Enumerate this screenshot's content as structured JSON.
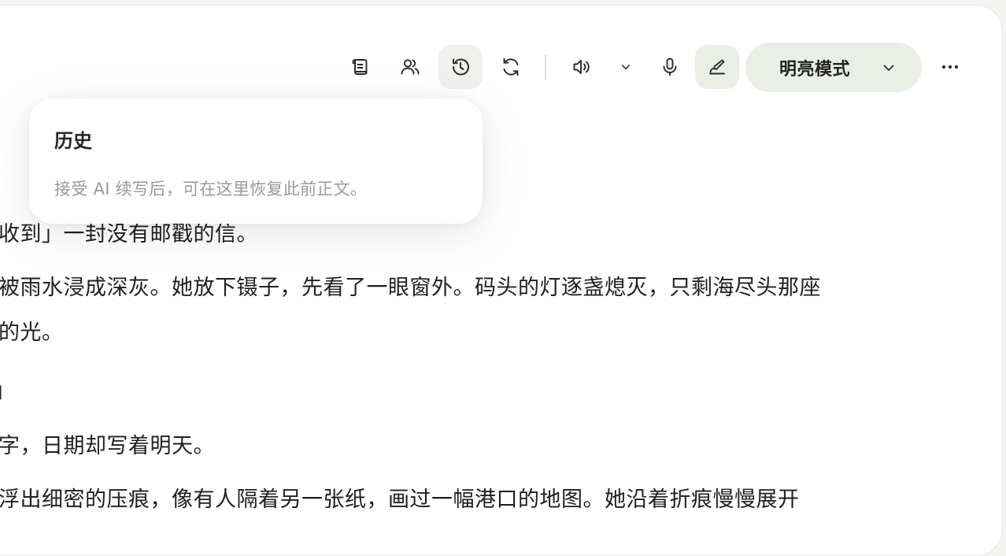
{
  "toolbar": {
    "icons": {
      "outline": "scroll-icon",
      "characters": "users-icon",
      "history": "history-icon",
      "regenerate": "refresh-icon",
      "voice": "speaker-icon",
      "voice_menu": "chevron-down-icon",
      "mic": "microphone-icon",
      "brush": "brush-icon",
      "more": "more-horizontal-icon"
    },
    "mode_label": "明亮模式"
  },
  "history_popover": {
    "title": "历史",
    "description": "接受 AI 续写后，可在这里恢复此前正文。"
  },
  "content": {
    "lines": [
      "收到」一封没有邮戳的信。",
      "被雨水浸成深灰。她放下镊子，先看了一眼窗外。码头的灯逐盏熄灭，只剩海尽头那座",
      "的光。",
      "」",
      "字，日期却写着明天。",
      "浮出细密的压痕，像有人隔着另一张纸，画过一幅港口的地图。她沿着折痕慢慢展开"
    ]
  },
  "colors": {
    "accent_green": "#e9efe6",
    "active_gray": "#f0f0ed",
    "text": "#1f1f1f",
    "muted": "#9a9a9a"
  }
}
